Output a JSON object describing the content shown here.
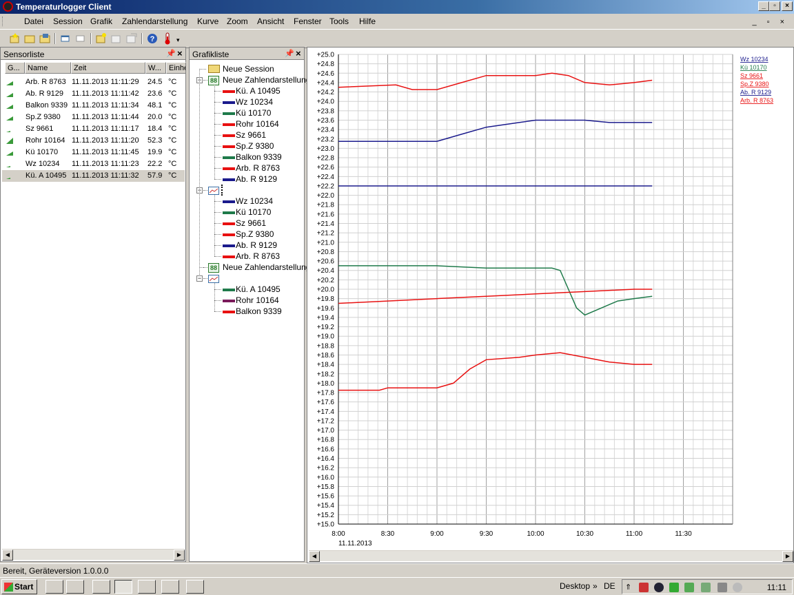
{
  "window": {
    "title": "Temperaturlogger Client"
  },
  "menu": [
    "Datei",
    "Session",
    "Grafik",
    "Zahlendarstellung",
    "Kurve",
    "Zoom",
    "Ansicht",
    "Fenster",
    "Tools",
    "Hilfe"
  ],
  "sensorlist": {
    "title": "Sensorliste",
    "columns": [
      "G...",
      "Name",
      "Zeit",
      "W...",
      "Einhe"
    ],
    "rows": [
      {
        "signal": "high",
        "name": "Arb. R 8763",
        "time": "11.11.2013 11:11:29",
        "value": "24.5",
        "unit": "°C"
      },
      {
        "signal": "high",
        "name": "Ab. R 9129",
        "time": "11.11.2013 11:11:42",
        "value": "23.6",
        "unit": "°C"
      },
      {
        "signal": "high",
        "name": "Balkon 9339",
        "time": "11.11.2013 11:11:34",
        "value": "48.1",
        "unit": "°C"
      },
      {
        "signal": "high",
        "name": "Sp.Z 9380",
        "time": "11.11.2013 11:11:44",
        "value": "20.0",
        "unit": "°C"
      },
      {
        "signal": "low",
        "name": "Sz 9661",
        "time": "11.11.2013 11:11:17",
        "value": "18.4",
        "unit": "°C"
      },
      {
        "signal": "full",
        "name": "Rohr 10164",
        "time": "11.11.2013 11:11:20",
        "value": "52.3",
        "unit": "°C"
      },
      {
        "signal": "high",
        "name": "Kü 10170",
        "time": "11.11.2013 11:11:45",
        "value": "19.9",
        "unit": "°C"
      },
      {
        "signal": "low",
        "name": "Wz 10234",
        "time": "11.11.2013 11:11:23",
        "value": "22.2",
        "unit": "°C"
      },
      {
        "signal": "low",
        "name": "Kü. A 10495",
        "time": "11.11.2013 11:11:32",
        "value": "57.9",
        "unit": "°C"
      }
    ]
  },
  "grafikliste": {
    "title": "Grafikliste",
    "session": "Neue Session",
    "groups": [
      {
        "kind": "num",
        "label": "Neue Zahlendarstellung",
        "items": [
          {
            "label": "Kü. A 10495",
            "color": "#e81010"
          },
          {
            "label": "Wz 10234",
            "color": "#1a1a8c"
          },
          {
            "label": "Kü 10170",
            "color": "#1e7a4a"
          },
          {
            "label": "Rohr 10164",
            "color": "#e81010"
          },
          {
            "label": "Sz 9661",
            "color": "#e81010"
          },
          {
            "label": "Sp.Z 9380",
            "color": "#e81010"
          },
          {
            "label": "Balkon 9339",
            "color": "#1e7a4a"
          },
          {
            "label": "Arb. R 8763",
            "color": "#e81010"
          },
          {
            "label": "Ab. R 9129",
            "color": "#1a1a8c"
          }
        ]
      },
      {
        "kind": "chart",
        "label": "",
        "items": [
          {
            "label": "Wz 10234",
            "color": "#1a1a8c"
          },
          {
            "label": "Kü 10170",
            "color": "#1e7a4a"
          },
          {
            "label": "Sz 9661",
            "color": "#e81010"
          },
          {
            "label": "Sp.Z 9380",
            "color": "#e81010"
          },
          {
            "label": "Ab. R 9129",
            "color": "#1a1a8c"
          },
          {
            "label": "Arb. R 8763",
            "color": "#e81010"
          }
        ]
      },
      {
        "kind": "num",
        "label": "Neue Zahlendarstellung",
        "items": []
      },
      {
        "kind": "chart",
        "label": "",
        "items": [
          {
            "label": "Kü. A 10495",
            "color": "#1e7a4a"
          },
          {
            "label": "Rohr 10164",
            "color": "#7a1a5a"
          },
          {
            "label": "Balkon 9339",
            "color": "#e81010"
          }
        ]
      }
    ]
  },
  "chart_data": {
    "type": "line",
    "ylim": [
      15.0,
      25.0
    ],
    "ytick_step": 0.2,
    "xlim": [
      "8:00",
      "12:00"
    ],
    "xticks": [
      "8:00",
      "8:30",
      "9:00",
      "9:30",
      "10:00",
      "10:30",
      "11:00",
      "11:30"
    ],
    "xdate": "11.11.2013",
    "grid": true,
    "legend_position": "top-right",
    "series": [
      {
        "name": "Wz 10234",
        "color": "#1a1a8c",
        "points": [
          [
            "8:00",
            22.2
          ],
          [
            "8:30",
            22.2
          ],
          [
            "9:00",
            22.2
          ],
          [
            "9:30",
            22.2
          ],
          [
            "10:00",
            22.2
          ],
          [
            "10:30",
            22.2
          ],
          [
            "11:00",
            22.2
          ],
          [
            "11:11",
            22.2
          ]
        ]
      },
      {
        "name": "Kü 10170",
        "color": "#1e7a4a",
        "points": [
          [
            "8:00",
            20.5
          ],
          [
            "8:30",
            20.5
          ],
          [
            "9:00",
            20.5
          ],
          [
            "9:30",
            20.45
          ],
          [
            "10:00",
            20.45
          ],
          [
            "10:10",
            20.45
          ],
          [
            "10:15",
            20.4
          ],
          [
            "10:20",
            20.0
          ],
          [
            "10:25",
            19.6
          ],
          [
            "10:30",
            19.45
          ],
          [
            "10:40",
            19.6
          ],
          [
            "10:50",
            19.75
          ],
          [
            "11:00",
            19.8
          ],
          [
            "11:11",
            19.85
          ]
        ]
      },
      {
        "name": "Sz 9661",
        "color": "#e81010",
        "points": [
          [
            "8:00",
            17.85
          ],
          [
            "8:25",
            17.85
          ],
          [
            "8:30",
            17.9
          ],
          [
            "9:00",
            17.9
          ],
          [
            "9:10",
            18.0
          ],
          [
            "9:20",
            18.3
          ],
          [
            "9:30",
            18.5
          ],
          [
            "9:50",
            18.55
          ],
          [
            "10:00",
            18.6
          ],
          [
            "10:15",
            18.65
          ],
          [
            "10:30",
            18.55
          ],
          [
            "10:45",
            18.45
          ],
          [
            "11:00",
            18.4
          ],
          [
            "11:11",
            18.4
          ]
        ]
      },
      {
        "name": "Sp.Z 9380",
        "color": "#e81010",
        "points": [
          [
            "8:00",
            19.7
          ],
          [
            "8:30",
            19.75
          ],
          [
            "9:00",
            19.8
          ],
          [
            "9:30",
            19.85
          ],
          [
            "10:00",
            19.9
          ],
          [
            "10:30",
            19.95
          ],
          [
            "11:00",
            20.0
          ],
          [
            "11:11",
            20.0
          ]
        ]
      },
      {
        "name": "Ab. R 9129",
        "color": "#1a1a8c",
        "points": [
          [
            "8:00",
            23.15
          ],
          [
            "8:40",
            23.15
          ],
          [
            "9:00",
            23.15
          ],
          [
            "9:15",
            23.3
          ],
          [
            "9:30",
            23.45
          ],
          [
            "9:50",
            23.55
          ],
          [
            "10:00",
            23.6
          ],
          [
            "10:30",
            23.6
          ],
          [
            "10:45",
            23.55
          ],
          [
            "11:11",
            23.55
          ]
        ]
      },
      {
        "name": "Arb. R 8763",
        "color": "#e81010",
        "points": [
          [
            "8:00",
            24.3
          ],
          [
            "8:35",
            24.35
          ],
          [
            "8:45",
            24.25
          ],
          [
            "9:00",
            24.25
          ],
          [
            "9:15",
            24.4
          ],
          [
            "9:30",
            24.55
          ],
          [
            "10:00",
            24.55
          ],
          [
            "10:10",
            24.6
          ],
          [
            "10:20",
            24.55
          ],
          [
            "10:30",
            24.4
          ],
          [
            "10:45",
            24.35
          ],
          [
            "11:00",
            24.4
          ],
          [
            "11:11",
            24.45
          ]
        ]
      }
    ]
  },
  "status": {
    "text": "Bereit, Geräteversion 1.0.0.0"
  },
  "taskbar": {
    "start": "Start",
    "desktop": "Desktop",
    "lang": "DE",
    "clock": "11:11"
  }
}
